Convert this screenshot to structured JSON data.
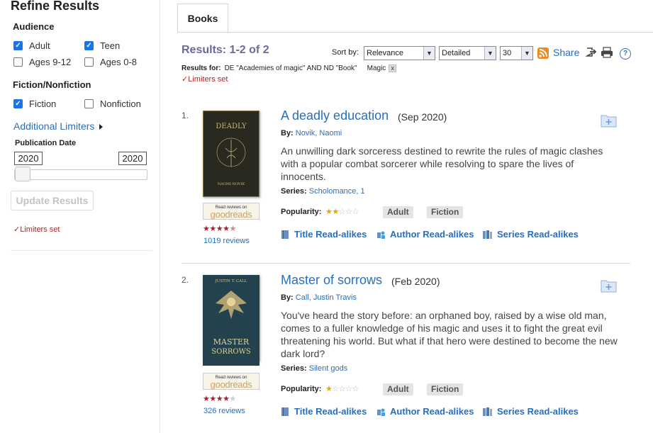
{
  "sidebar": {
    "title": "Refine Results",
    "audience": {
      "heading": "Audience",
      "options": [
        {
          "label": "Adult",
          "checked": true
        },
        {
          "label": "Teen",
          "checked": true
        },
        {
          "label": "Ages 9-12",
          "checked": false
        },
        {
          "label": "Ages 0-8",
          "checked": false
        }
      ]
    },
    "fiction": {
      "heading": "Fiction/Nonfiction",
      "options": [
        {
          "label": "Fiction",
          "checked": true
        },
        {
          "label": "Nonfiction",
          "checked": false
        }
      ]
    },
    "additional_limiters": "Additional Limiters",
    "pub_date": {
      "label": "Publication Date",
      "from": "2020",
      "to": "2020"
    },
    "update_button": "Update Results",
    "limiters_set": "✓Limiters set"
  },
  "tabs": {
    "books": "Books"
  },
  "toolbar": {
    "results_count": "Results: 1-2 of 2",
    "sort_label": "Sort by:",
    "sort_value": "Relevance",
    "view_value": "Detailed",
    "per_page_value": "30",
    "share": "Share",
    "help": "?"
  },
  "query": {
    "results_for_label": "Results for:",
    "query_text": "DE \"Academies of magic\" AND ND \"Book\"",
    "facet": "Magic",
    "facet_remove": "x",
    "limiters_set": "✓Limiters set"
  },
  "records": [
    {
      "num": "1.",
      "title": "A deadly education",
      "date": "(Sep 2020)",
      "by_label": "By:",
      "author": "Novik, Naomi",
      "description": "An unwilling dark sorceress destined to rewrite the rules of magic clashes with a popular combat sorcerer while resolving to spare the lives of innocents.",
      "series_label": "Series:",
      "series": "Scholomance, 1",
      "popularity_label": "Popularity:",
      "popularity_stars": 2,
      "tags": [
        "Adult",
        "Fiction"
      ],
      "goodreads_small": "Read reviews on",
      "goodreads_big": "goodreads",
      "goodreads_rating": 4.5,
      "reviews": "1019 reviews",
      "cover_title": "DEADLY",
      "cover_author": "NAOMI NOVIK",
      "alikes": {
        "title": "Title Read-alikes",
        "author": "Author Read-alikes",
        "series": "Series Read-alikes"
      }
    },
    {
      "num": "2.",
      "title": "Master of sorrows",
      "date": "(Feb 2020)",
      "by_label": "By:",
      "author": "Call, Justin Travis",
      "description": "You've heard the story before: an orphaned boy, raised by a wise old man, comes to a fuller knowledge of his magic and uses it to fight the great evil threatening his world. But what if that hero were destined to become the new dark lord?",
      "series_label": "Series:",
      "series": "Silent gods",
      "popularity_label": "Popularity:",
      "popularity_stars": 1,
      "tags": [
        "Adult",
        "Fiction"
      ],
      "goodreads_small": "Read reviews on",
      "goodreads_big": "goodreads",
      "goodreads_rating": 4,
      "reviews": "326 reviews",
      "cover_top": "JUSTIN T. CALL",
      "cover_title": "MASTER",
      "cover_title2": "SORROWS",
      "alikes": {
        "title": "Title Read-alikes",
        "author": "Author Read-alikes",
        "series": "Series Read-alikes"
      }
    }
  ],
  "colors": {
    "link": "#2a6ebb",
    "limiter_red": "#b22222",
    "results_purple": "#6a6a9a"
  }
}
